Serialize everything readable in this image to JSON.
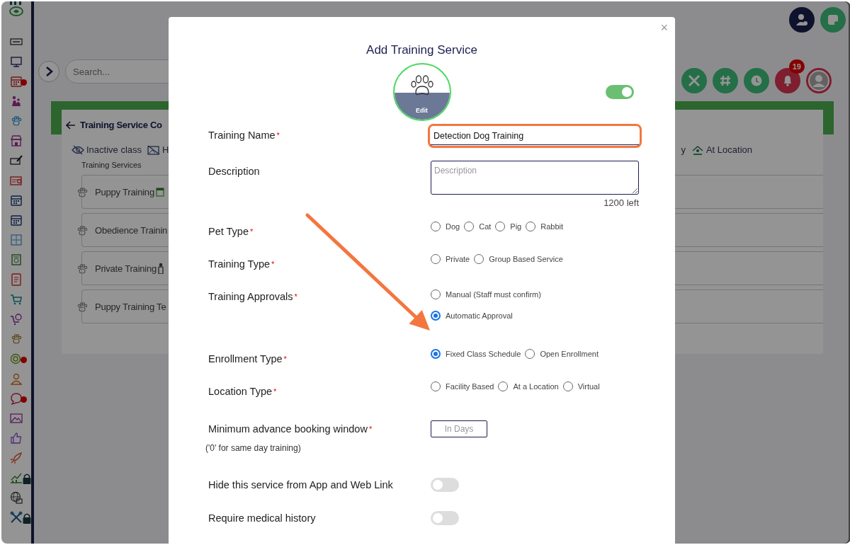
{
  "sidebar": {
    "items": [
      {
        "alert": false,
        "locked": false
      },
      {
        "alert": false,
        "locked": false
      },
      {
        "alert": true,
        "locked": false
      },
      {
        "alert": false,
        "locked": false
      },
      {
        "alert": false,
        "locked": false
      },
      {
        "alert": false,
        "locked": false
      },
      {
        "alert": false,
        "locked": false
      },
      {
        "alert": false,
        "locked": false
      },
      {
        "alert": false,
        "locked": false
      },
      {
        "alert": false,
        "locked": false
      },
      {
        "alert": false,
        "locked": false
      },
      {
        "alert": false,
        "locked": false
      },
      {
        "alert": false,
        "locked": false
      },
      {
        "alert": false,
        "locked": false
      },
      {
        "alert": false,
        "locked": false
      },
      {
        "alert": false,
        "locked": false
      },
      {
        "alert": true,
        "locked": false
      },
      {
        "alert": false,
        "locked": false
      },
      {
        "alert": true,
        "locked": false
      },
      {
        "alert": false,
        "locked": false
      },
      {
        "alert": false,
        "locked": false
      },
      {
        "alert": false,
        "locked": false
      },
      {
        "alert": false,
        "locked": true
      },
      {
        "alert": false,
        "locked": false
      },
      {
        "alert": false,
        "locked": true
      }
    ]
  },
  "topbar": {
    "search": {
      "placeholder": "Search..."
    },
    "notifications": {
      "count": "19"
    }
  },
  "page": {
    "title": "Training Service Co",
    "filters": [
      {
        "kind": "hidden",
        "label": "Inactive class"
      },
      {
        "kind": "no-image",
        "label": "H"
      },
      {
        "kind": "plain",
        "label": "y"
      },
      {
        "kind": "location",
        "label": "At Location"
      }
    ],
    "section_label": "Training Services",
    "services": [
      {
        "name": "Puppy Training",
        "kind": "scheduled"
      },
      {
        "name": "Obedience Trainin",
        "kind": "plain"
      },
      {
        "name": "Private Training",
        "kind": "private"
      },
      {
        "name": "Puppy Training Te",
        "kind": "plain"
      }
    ]
  },
  "dialog": {
    "title": "Add Training Service",
    "close": "×",
    "image_label": "Edit",
    "active": true,
    "fields": [
      {
        "kind": "text",
        "label": "Training Name",
        "required_mark": "*",
        "value": "Detection Dog Training",
        "highlighted": true
      },
      {
        "kind": "textarea",
        "label": "Description",
        "placeholder": "Description",
        "counter": "1200 left"
      },
      {
        "kind": "radio",
        "label": "Pet Type",
        "required_mark": "*",
        "options": [
          {
            "label": "Dog",
            "selected": false
          },
          {
            "label": "Cat",
            "selected": false
          },
          {
            "label": "Pig",
            "selected": false
          },
          {
            "label": "Rabbit",
            "selected": false
          }
        ]
      },
      {
        "kind": "radio",
        "label": "Training Type",
        "required_mark": "*",
        "options": [
          {
            "label": "Private",
            "selected": false
          },
          {
            "label": "Group Based Service",
            "selected": false
          }
        ]
      },
      {
        "kind": "radio",
        "label": "Training Approvals",
        "required_mark": "*",
        "stacked": true,
        "options": [
          {
            "label": "Manual (Staff must confirm)",
            "selected": false
          },
          {
            "label": "Automatic Approval",
            "selected": true
          }
        ]
      },
      {
        "kind": "radio",
        "label": "Enrollment Type",
        "required_mark": "*",
        "options": [
          {
            "label": "Fixed Class Schedule",
            "selected": true
          },
          {
            "label": "Open Enrollment",
            "selected": false
          }
        ]
      },
      {
        "kind": "radio",
        "label": "Location Type",
        "required_mark": "*",
        "options": [
          {
            "label": "Facility Based",
            "selected": false
          },
          {
            "label": "At a Location",
            "selected": false
          },
          {
            "label": "Virtual",
            "selected": false
          }
        ]
      },
      {
        "kind": "number",
        "label": "Minimum advance booking window",
        "required_mark": "*",
        "placeholder": "In Days",
        "hint": "('0' for same day training)"
      },
      {
        "kind": "toggle",
        "label": "Hide this service from App and Web Link",
        "on": false
      },
      {
        "kind": "toggle",
        "label": "Require medical history",
        "on": false
      }
    ]
  }
}
